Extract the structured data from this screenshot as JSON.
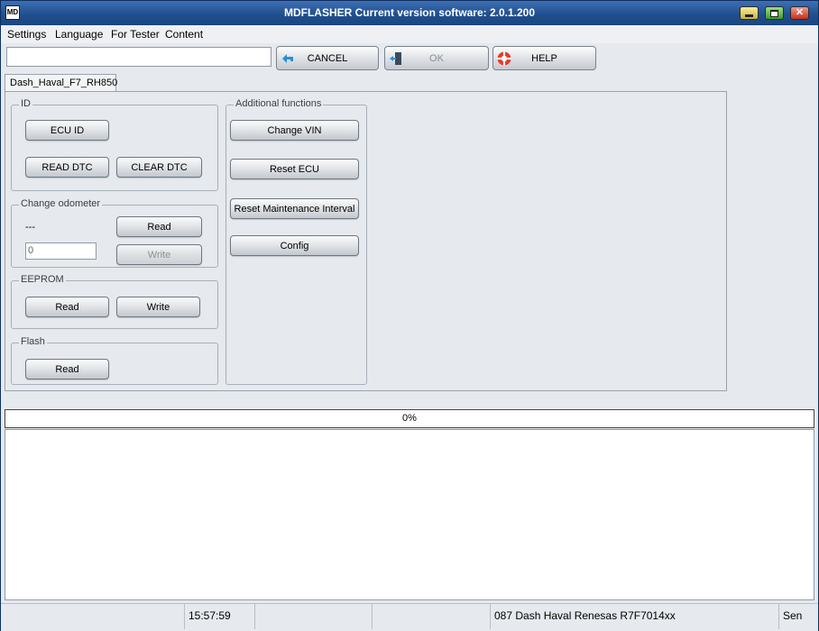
{
  "window": {
    "title": "MDFLASHER  Current version software: 2.0.1.200",
    "app_icon_text": "MD"
  },
  "menu": [
    "Settings",
    "Language",
    "For Tester",
    "Content"
  ],
  "toolbar": {
    "input_value": "",
    "cancel_label": "CANCEL",
    "ok_label": "OK",
    "help_label": "HELP"
  },
  "tab": {
    "label": "Dash_Haval_F7_RH850"
  },
  "groups": {
    "id": {
      "title": "ID",
      "ecu_id": "ECU ID",
      "read_dtc": "READ DTC",
      "clear_dtc": "CLEAR DTC"
    },
    "odometer": {
      "title": "Change odometer",
      "value": "---",
      "input_value": "0",
      "read": "Read",
      "write": "Write"
    },
    "eeprom": {
      "title": "EEPROM",
      "read": "Read",
      "write": "Write"
    },
    "flash": {
      "title": "Flash",
      "read": "Read"
    },
    "additional": {
      "title": "Additional functions",
      "change_vin": "Change VIN",
      "reset_ecu": "Reset ECU",
      "reset_maintenance": "Reset Maintenance Interval",
      "config": "Config"
    }
  },
  "progress": {
    "percent": 0,
    "text": "0%"
  },
  "status": {
    "time": "15:57:59",
    "device": "087 Dash Haval Renesas R7F7014xx",
    "extra": "Sen"
  },
  "colors": {
    "title_bar": "#21508f",
    "background": "#e6e9ed"
  }
}
